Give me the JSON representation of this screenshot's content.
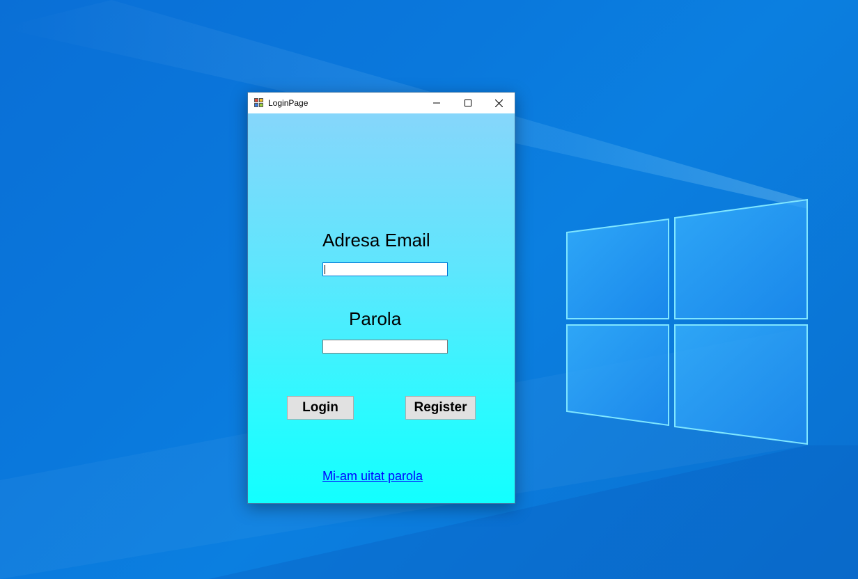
{
  "window": {
    "title": "LoginPage",
    "controls": {
      "minimize_icon": "minimize-icon",
      "maximize_icon": "maximize-icon",
      "close_icon": "close-icon"
    }
  },
  "form": {
    "email_label": "Adresa Email",
    "email_value": "",
    "password_label": "Parola",
    "password_value": "",
    "login_button": "Login",
    "register_button": "Register",
    "forgot_link": "Mi-am uitat parola"
  },
  "colors": {
    "desktop_blue": "#0a78dc",
    "form_gradient_top": "#86d6fb",
    "form_gradient_bottom": "#12ffff",
    "link": "#0000ff",
    "focus_border": "#0078d7"
  }
}
